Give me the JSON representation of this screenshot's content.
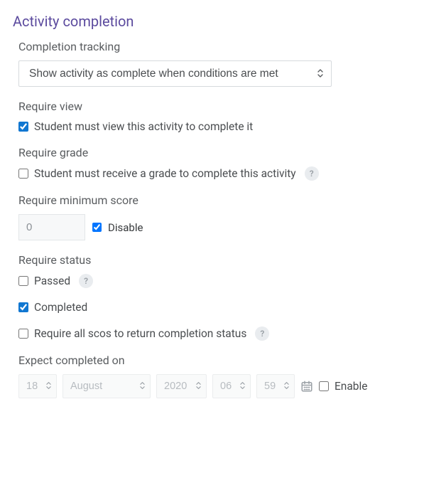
{
  "section_title": "Activity completion",
  "completion_tracking": {
    "label": "Completion tracking",
    "selected": "Show activity as complete when conditions are met"
  },
  "require_view": {
    "label": "Require view",
    "checkbox_label": "Student must view this activity to complete it",
    "checked": true
  },
  "require_grade": {
    "label": "Require grade",
    "checkbox_label": "Student must receive a grade to complete this activity",
    "checked": false
  },
  "require_min_score": {
    "label": "Require minimum score",
    "value": "0",
    "disable_label": "Disable",
    "disable_checked": true
  },
  "require_status": {
    "label": "Require status",
    "passed_label": "Passed",
    "passed_checked": false,
    "completed_label": "Completed",
    "completed_checked": true
  },
  "require_all_scos": {
    "label": "Require all scos to return completion status",
    "checked": false
  },
  "expect_completed": {
    "label": "Expect completed on",
    "day": "18",
    "month": "August",
    "year": "2020",
    "hour": "06",
    "minute": "59",
    "enable_label": "Enable",
    "enable_checked": false
  }
}
